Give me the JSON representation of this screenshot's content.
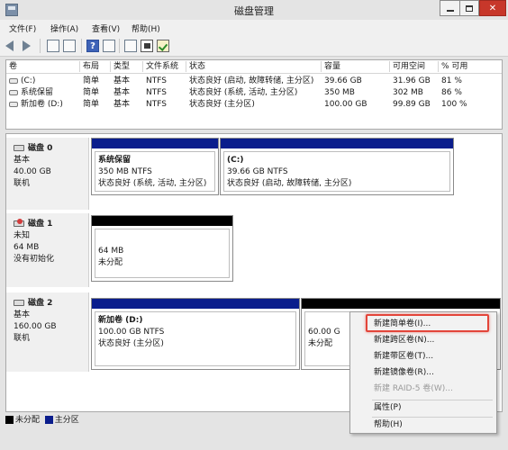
{
  "window": {
    "title": "磁盘管理",
    "close": "✕"
  },
  "menu": [
    "文件(F)",
    "操作(A)",
    "查看(V)",
    "帮助(H)"
  ],
  "toolbar": {
    "help": "?"
  },
  "volume_list": {
    "headers": [
      "卷",
      "布局",
      "类型",
      "文件系统",
      "状态",
      "容量",
      "可用空间",
      "% 可用"
    ],
    "rows": [
      [
        "(C:)",
        "简单",
        "基本",
        "NTFS",
        "状态良好 (启动, 故障转储, 主分区)",
        "39.66 GB",
        "31.96 GB",
        "81 %"
      ],
      [
        "系统保留",
        "简单",
        "基本",
        "NTFS",
        "状态良好 (系统, 活动, 主分区)",
        "350 MB",
        "302 MB",
        "86 %"
      ],
      [
        "新加卷 (D:)",
        "简单",
        "基本",
        "NTFS",
        "状态良好 (主分区)",
        "100.00 GB",
        "99.89 GB",
        "100 %"
      ]
    ]
  },
  "disks": [
    {
      "name": "磁盘 0",
      "type": "基本",
      "size": "40.00 GB",
      "status": "联机",
      "partitions": [
        {
          "name": "系统保留",
          "size": "350 MB NTFS",
          "status": "状态良好 (系统, 活动, 主分区)"
        },
        {
          "name": "(C:)",
          "size": "39.66 GB NTFS",
          "status": "状态良好 (启动, 故障转储, 主分区)"
        }
      ]
    },
    {
      "name": "磁盘 1",
      "type": "未知",
      "size": "64 MB",
      "status": "没有初始化",
      "partitions": [
        {
          "size": "64 MB",
          "status": "未分配"
        }
      ]
    },
    {
      "name": "磁盘 2",
      "type": "基本",
      "size": "160.00 GB",
      "status": "联机",
      "partitions": [
        {
          "name": "新加卷  (D:)",
          "size": "100.00 GB NTFS",
          "status": "状态良好 (主分区)"
        },
        {
          "size": "60.00 G",
          "status": "未分配"
        }
      ]
    }
  ],
  "legend": {
    "unallocated": "未分配",
    "primary": "主分区"
  },
  "context_menu": {
    "items": [
      "新建简单卷(I)...",
      "新建跨区卷(N)...",
      "新建带区卷(T)...",
      "新建镜像卷(R)...",
      "新建 RAID-5 卷(W)...",
      "属性(P)",
      "帮助(H)"
    ],
    "highlighted": "新建简单卷(I)..."
  },
  "colors": {
    "primary_partition": "#0a1d8c",
    "unallocated": "#000000",
    "highlight": "#e3453a"
  }
}
